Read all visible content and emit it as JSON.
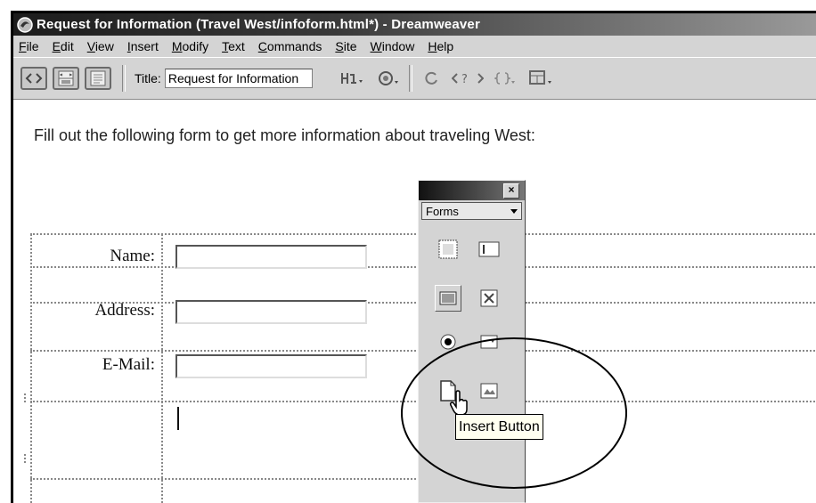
{
  "window": {
    "title": "Request for Information (Travel West/infoform.html*) - Dreamweaver"
  },
  "menu": [
    "File",
    "Edit",
    "View",
    "Insert",
    "Modify",
    "Text",
    "Commands",
    "Site",
    "Window",
    "Help"
  ],
  "toolbar": {
    "title_label": "Title:",
    "title_value": "Request for Information"
  },
  "document": {
    "intro": "Fill out the following form to get more information about traveling West:",
    "fields": [
      {
        "label": "Name:"
      },
      {
        "label": "Address:"
      },
      {
        "label": "E-Mail:"
      }
    ]
  },
  "panel": {
    "category": "Forms",
    "close_glyph": "×"
  },
  "tooltip": "Insert Button"
}
